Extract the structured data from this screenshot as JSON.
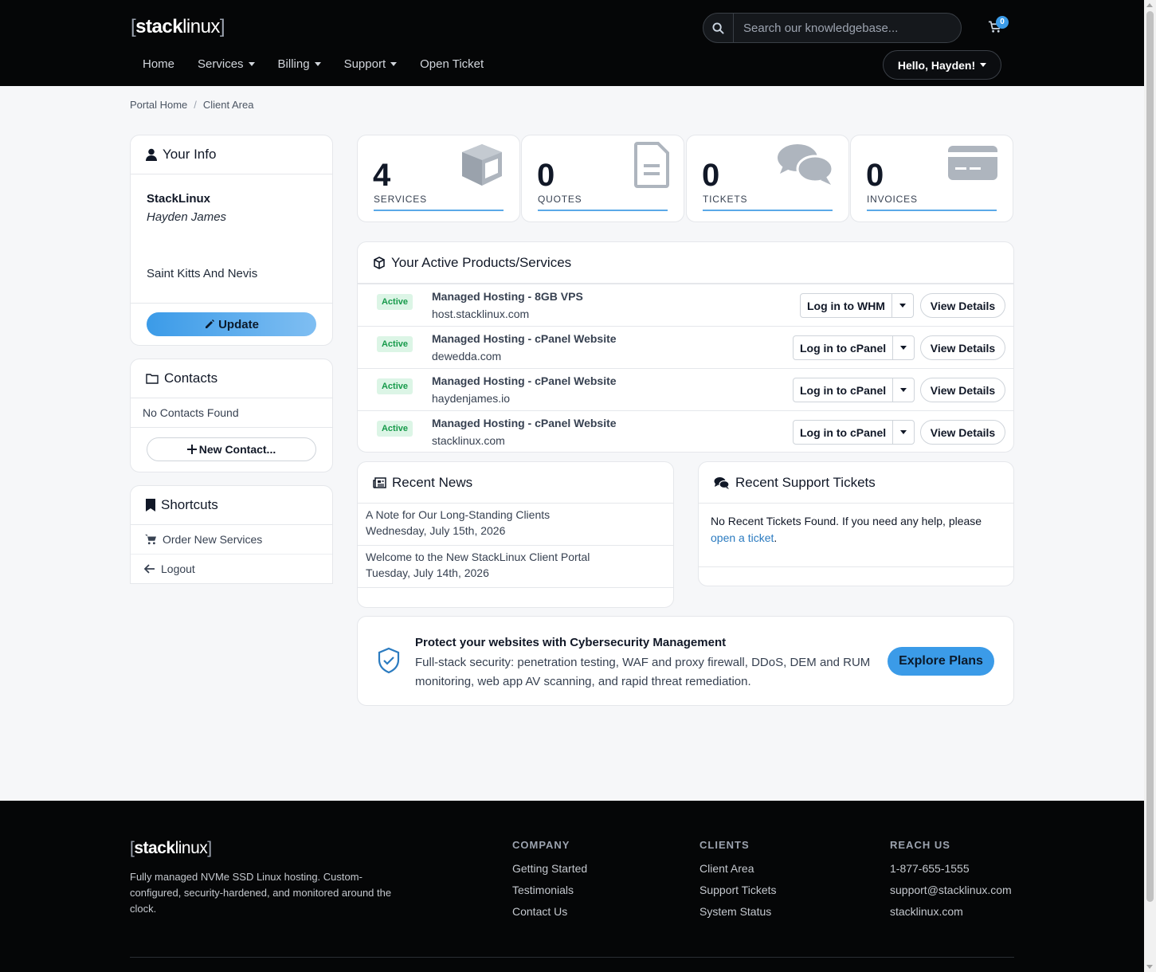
{
  "brand": {
    "logo_open": "[",
    "logo_bold": "stack",
    "logo_light": "linux",
    "logo_close": "]"
  },
  "header": {
    "search_placeholder": "Search our knowledgebase...",
    "cart_count": "0",
    "nav": [
      {
        "label": "Home"
      },
      {
        "label": "Services"
      },
      {
        "label": "Billing"
      },
      {
        "label": "Support"
      },
      {
        "label": "Open Ticket"
      }
    ],
    "user_menu": "Hello, Hayden!"
  },
  "breadcrumb": {
    "home": "Portal Home",
    "sep": "/",
    "current": "Client Area"
  },
  "your_info": {
    "title": "Your Info",
    "company": "StackLinux",
    "name": "Hayden James",
    "country": "Saint Kitts And Nevis",
    "update_label": "Update"
  },
  "contacts": {
    "title": "Contacts",
    "empty": "No Contacts Found",
    "new_label": "New Contact..."
  },
  "shortcuts": {
    "title": "Shortcuts",
    "items": [
      {
        "label": "Order New Services"
      },
      {
        "label": "Logout"
      }
    ]
  },
  "stats": [
    {
      "count": "4",
      "label": "SERVICES",
      "icon": "cube-icon"
    },
    {
      "count": "0",
      "label": "QUOTES",
      "icon": "document-icon"
    },
    {
      "count": "0",
      "label": "TICKETS",
      "icon": "comments-icon"
    },
    {
      "count": "0",
      "label": "INVOICES",
      "icon": "credit-card-icon"
    }
  ],
  "products": {
    "title": "Your Active Products/Services",
    "items": [
      {
        "status": "Active",
        "name": "Managed Hosting - 8GB VPS",
        "domain": "host.stacklinux.com",
        "login": "Log in to WHM",
        "details": "View Details"
      },
      {
        "status": "Active",
        "name": "Managed Hosting - cPanel Website",
        "domain": "dewedda.com",
        "login": "Log in to cPanel",
        "details": "View Details"
      },
      {
        "status": "Active",
        "name": "Managed Hosting - cPanel Website",
        "domain": "haydenjames.io",
        "login": "Log in to cPanel",
        "details": "View Details"
      },
      {
        "status": "Active",
        "name": "Managed Hosting - cPanel Website",
        "domain": "stacklinux.com",
        "login": "Log in to cPanel",
        "details": "View Details"
      }
    ]
  },
  "news": {
    "title": "Recent News",
    "items": [
      {
        "title": "A Note for Our Long-Standing Clients",
        "date": "Wednesday, July 15th, 2026"
      },
      {
        "title": "Welcome to the New StackLinux Client Portal",
        "date": "Tuesday, July 14th, 2026"
      }
    ]
  },
  "tickets": {
    "title": "Recent Support Tickets",
    "text": "No Recent Tickets Found. If you need any help, please",
    "link": "open a ticket",
    "tail": "."
  },
  "promo": {
    "title": "Protect your websites with Cybersecurity Management",
    "description": "Full-stack security: penetration testing, WAF and proxy firewall, DDoS, DEM and RUM monitoring, web app AV scanning, and rapid threat remediation.",
    "cta": "Explore Plans"
  },
  "footer": {
    "description": "Fully managed NVMe SSD Linux hosting. Custom-configured, security-hardened, and monitored around the clock.",
    "columns": [
      {
        "title": "COMPANY",
        "links": [
          "Getting Started",
          "Testimonials",
          "Contact Us"
        ]
      },
      {
        "title": "CLIENTS",
        "links": [
          "Client Area",
          "Support Tickets",
          "System Status"
        ]
      },
      {
        "title": "REACH US",
        "links": [
          "1-877-655-1555",
          "support@stacklinux.com",
          "stacklinux.com"
        ]
      }
    ]
  },
  "colors": {
    "accent": "#3b9be8",
    "header_bg": "#050607",
    "active_badge": "#169a4a",
    "link": "#2b7bc0"
  }
}
